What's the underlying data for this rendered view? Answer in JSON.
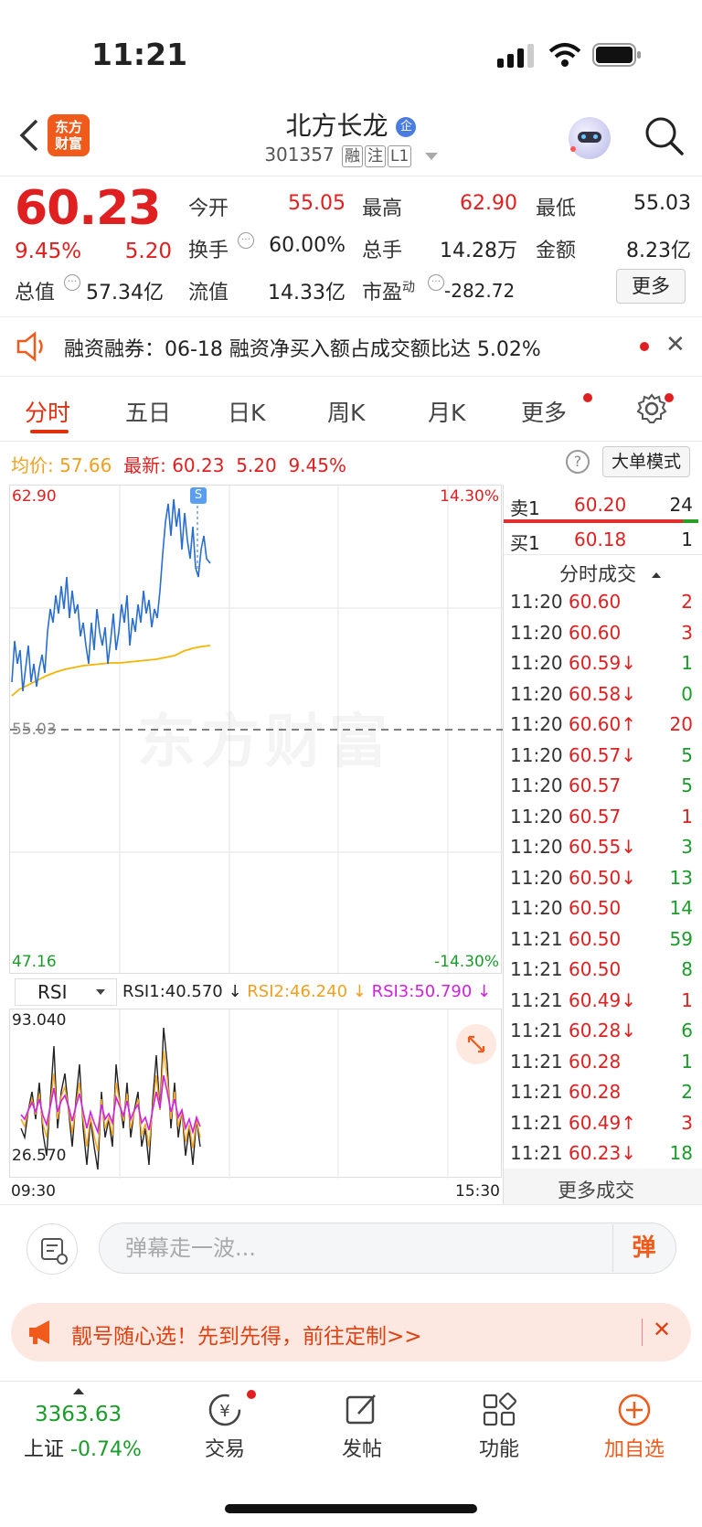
{
  "status_bar": {
    "time": "11:21"
  },
  "header": {
    "logo_line1": "东方",
    "logo_line2": "财富",
    "stock_name": "北方长龙",
    "name_badge": "企",
    "stock_code": "301357",
    "tags": [
      "融",
      "注",
      "L1"
    ]
  },
  "quote": {
    "price": "60.23",
    "change_pct": "9.45%",
    "change": "5.20",
    "rows": [
      {
        "l1": "今开",
        "v1": "55.05",
        "l2": "最高",
        "v2": "62.90",
        "l3": "最低",
        "v3": "55.03"
      },
      {
        "l1": "换手",
        "v1": "60.00%",
        "l2": "总手",
        "v2": "14.28万",
        "l3": "金额",
        "v3": "8.23亿"
      }
    ],
    "total_value_label": "总值",
    "total_value": "57.34亿",
    "float_value_label": "流值",
    "float_value": "14.33亿",
    "pe_label": "市盈",
    "pe_sup": "动",
    "pe_value": "-282.72",
    "more_label": "更多"
  },
  "notice": {
    "text": "融资融券：06-18 融资净买入额占成交额比达 5.02%"
  },
  "tabs": [
    "分时",
    "五日",
    "日K",
    "周K",
    "月K",
    "更多"
  ],
  "info": {
    "avg_label": "均价:",
    "avg_value": "57.66",
    "latest_label": "最新:",
    "latest_value": "60.23",
    "latest_change": "5.20",
    "latest_pct": "9.45%",
    "help": "?",
    "mode_label": "大单模式"
  },
  "chart": {
    "y_max": "62.90",
    "y_min": "47.16",
    "y_base": "55.03",
    "pct_max": "14.30%",
    "pct_min": "-14.30%",
    "marker": "S",
    "watermark": "东方财富"
  },
  "rsi": {
    "selector": "RSI",
    "rsi1": "RSI1:40.570 ↓",
    "rsi2": "RSI2:46.240 ↓",
    "rsi3": "RSI3:50.790 ↓",
    "y_max": "93.040",
    "y_min": "26.570",
    "x_start": "09:30",
    "x_end": "15:30"
  },
  "orderbook": {
    "sell_label": "卖1",
    "sell_price": "60.20",
    "sell_vol": "24",
    "buy_label": "买1",
    "buy_price": "60.18",
    "buy_vol": "1"
  },
  "trades_title": "分时成交",
  "trades": [
    {
      "time": "11:20",
      "price": "60.60",
      "vol": "2",
      "c": "red"
    },
    {
      "time": "11:20",
      "price": "60.60",
      "vol": "3",
      "c": "red"
    },
    {
      "time": "11:20",
      "price": "60.59↓",
      "vol": "1",
      "c": "green"
    },
    {
      "time": "11:20",
      "price": "60.58↓",
      "vol": "0",
      "c": "green"
    },
    {
      "time": "11:20",
      "price": "60.60↑",
      "vol": "20",
      "c": "red"
    },
    {
      "time": "11:20",
      "price": "60.57↓",
      "vol": "5",
      "c": "green"
    },
    {
      "time": "11:20",
      "price": "60.57",
      "vol": "5",
      "c": "green"
    },
    {
      "time": "11:20",
      "price": "60.57",
      "vol": "1",
      "c": "red"
    },
    {
      "time": "11:20",
      "price": "60.55↓",
      "vol": "3",
      "c": "green"
    },
    {
      "time": "11:20",
      "price": "60.50↓",
      "vol": "13",
      "c": "green"
    },
    {
      "time": "11:20",
      "price": "60.50",
      "vol": "14",
      "c": "green"
    },
    {
      "time": "11:21",
      "price": "60.50",
      "vol": "59",
      "c": "green"
    },
    {
      "time": "11:21",
      "price": "60.50",
      "vol": "8",
      "c": "green"
    },
    {
      "time": "11:21",
      "price": "60.49↓",
      "vol": "1",
      "c": "red"
    },
    {
      "time": "11:21",
      "price": "60.28↓",
      "vol": "6",
      "c": "green"
    },
    {
      "time": "11:21",
      "price": "60.28",
      "vol": "1",
      "c": "green"
    },
    {
      "time": "11:21",
      "price": "60.28",
      "vol": "2",
      "c": "green"
    },
    {
      "time": "11:21",
      "price": "60.49↑",
      "vol": "3",
      "c": "red"
    },
    {
      "time": "11:21",
      "price": "60.23↓",
      "vol": "18",
      "c": "green"
    }
  ],
  "more_trades": "更多成交",
  "comment": {
    "placeholder": "弹幕走一波...",
    "send": "弹"
  },
  "promo": {
    "text": "靓号随心选！先到先得，前往定制>>"
  },
  "bottom_nav": {
    "index_value": "3363.63",
    "index_name": "上证",
    "index_change": "-0.74%",
    "items": [
      "交易",
      "发帖",
      "功能",
      "加自选"
    ]
  }
}
